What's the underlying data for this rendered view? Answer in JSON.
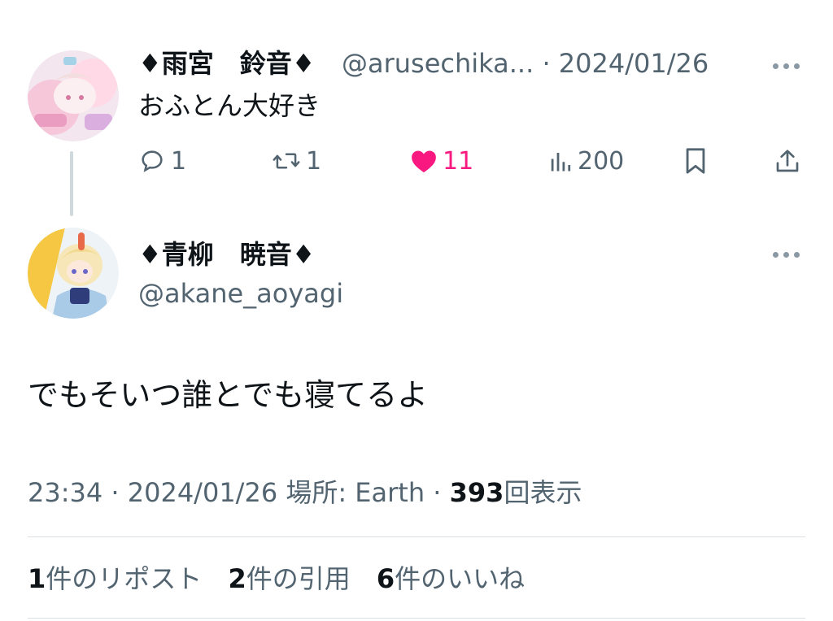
{
  "reply_parent": {
    "display_name": "♦雨宮　鈴音♦",
    "handle": "@arusechika...",
    "separator": "·",
    "date": "2024/01/26",
    "text": "おふとん大好き",
    "metrics": {
      "replies": "1",
      "reposts": "1",
      "likes": "11",
      "views": "200"
    },
    "avatar_icon": "avatar-pink-illustration"
  },
  "main_post": {
    "display_name": "♦青柳　暁音♦",
    "handle": "@akane_aoyagi",
    "text": "でもそいつ誰とでも寝てるよ",
    "time": "23:34",
    "date": "2024/01/26",
    "location_label": "場所: Earth",
    "separator": "·",
    "view_count": "393",
    "view_label": "回表示",
    "avatar_icon": "avatar-blonde-illustration"
  },
  "stats": {
    "reposts_count": "1",
    "reposts_label": "件のリポスト",
    "quotes_count": "2",
    "quotes_label": "件の引用",
    "likes_count": "6",
    "likes_label": "件のいいね"
  },
  "colors": {
    "text": "#0f1419",
    "secondary": "#536471",
    "like": "#f91880",
    "divider": "#d9dfe3"
  }
}
